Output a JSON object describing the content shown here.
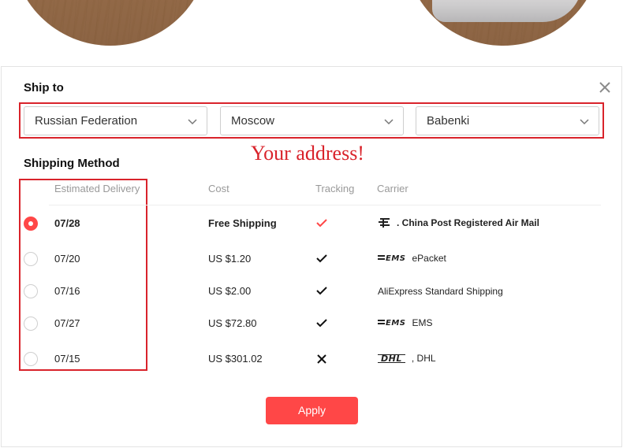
{
  "dialog": {
    "ship_to_title": "Ship to",
    "shipping_method_title": "Shipping Method",
    "annotation": "Your address!",
    "apply_label": "Apply"
  },
  "address": {
    "country": "Russian Federation",
    "region": "Moscow",
    "city": "Babenki"
  },
  "table": {
    "headers": {
      "delivery": "Estimated Delivery",
      "cost": "Cost",
      "tracking": "Tracking",
      "carrier": "Carrier"
    },
    "rows": [
      {
        "date": "07/28",
        "cost": "Free Shipping",
        "tracking": "check-red-icon",
        "carrier_logo": "china-post-logo",
        "carrier_logo_text": "",
        "carrier": ". China Post Registered Air Mail",
        "selected": true
      },
      {
        "date": "07/20",
        "cost": "US $1.20",
        "tracking": "check-icon",
        "carrier_logo": "ems-logo",
        "carrier_logo_text": "EMS",
        "carrier": "ePacket",
        "selected": false
      },
      {
        "date": "07/16",
        "cost": "US $2.00",
        "tracking": "check-icon",
        "carrier_logo": "",
        "carrier_logo_text": "",
        "carrier": "AliExpress Standard Shipping",
        "selected": false
      },
      {
        "date": "07/27",
        "cost": "US $72.80",
        "tracking": "check-icon",
        "carrier_logo": "ems-logo",
        "carrier_logo_text": "EMS",
        "carrier": "EMS",
        "selected": false
      },
      {
        "date": "07/15",
        "cost": "US $301.02",
        "tracking": "cross-icon",
        "carrier_logo": "dhl-logo",
        "carrier_logo_text": "DHL",
        "carrier": ", DHL",
        "selected": false
      }
    ]
  },
  "colors": {
    "accent": "#ff4747",
    "annotation_red": "#d9232b"
  }
}
